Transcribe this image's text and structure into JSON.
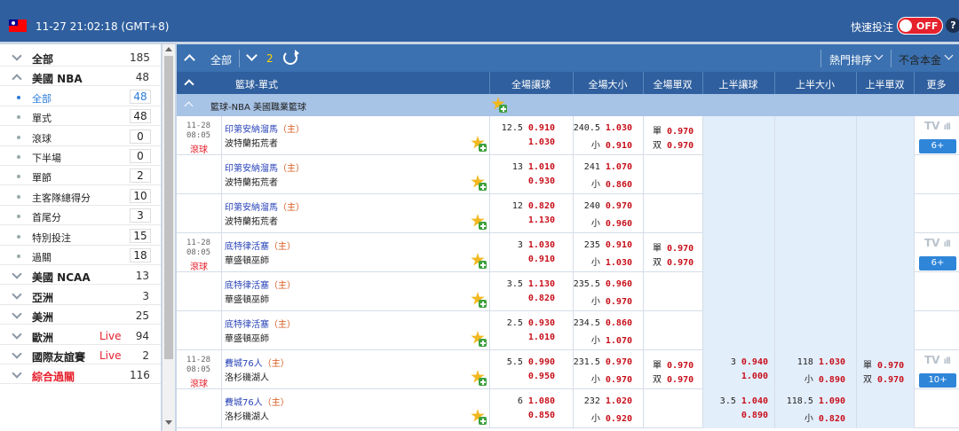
{
  "header": {
    "datetime": "11-27 21:02:18 (GMT+8)",
    "quick_bet_label": "快速投注",
    "quick_bet_state": "OFF",
    "help_label": "?",
    "colors": {
      "top_bar": "#2f5f9e",
      "toggle": "#e5212d"
    }
  },
  "sidebar": {
    "items": [
      {
        "label": "全部",
        "count": "185",
        "expanded": false
      },
      {
        "label": "美國 NBA",
        "count": "48",
        "expanded": true
      },
      {
        "label": "全部",
        "count": "48",
        "sub": true,
        "active": true
      },
      {
        "label": "單式",
        "count": "48",
        "sub": true
      },
      {
        "label": "滾球",
        "count": "0",
        "sub": true
      },
      {
        "label": "下半場",
        "count": "0",
        "sub": true
      },
      {
        "label": "單節",
        "count": "2",
        "sub": true
      },
      {
        "label": "主客隊總得分",
        "count": "10",
        "sub": true
      },
      {
        "label": "首尾分",
        "count": "3",
        "sub": true
      },
      {
        "label": "特別投注",
        "count": "15",
        "sub": true
      },
      {
        "label": "過關",
        "count": "18",
        "sub": true
      },
      {
        "label": "美國 NCAA",
        "count": "13",
        "expanded": false
      },
      {
        "label": "亞洲",
        "count": "3",
        "expanded": false
      },
      {
        "label": "美洲",
        "count": "25",
        "expanded": false
      },
      {
        "label": "歐洲",
        "count": "94",
        "live": "Live",
        "expanded": false
      },
      {
        "label": "國際友誼賽",
        "count": "2",
        "live": "Live",
        "expanded": false
      },
      {
        "label": "綜合過關",
        "count": "116",
        "highlight": true,
        "expanded": false
      }
    ]
  },
  "toolbar": {
    "all_label": "全部",
    "collapse_count": "2",
    "sort_label": "熱門排序",
    "odds_label": "不含本金"
  },
  "table": {
    "headers": [
      "籃球-單式",
      "全場讓球",
      "全場大小",
      "全場單双",
      "上半讓球",
      "上半大小",
      "上半單双",
      "更多"
    ],
    "league": "籃球-NBA 美國職業籃球",
    "home_suffix": "（主）",
    "matches": [
      {
        "date": "11-28",
        "time": "08:05",
        "live": "滾球",
        "home": "印第安納溜馬",
        "away": "波特蘭拓荒者",
        "hdp": "12.5",
        "hdp_h": "0.910",
        "hdp_a": "1.030",
        "ou": "240.5",
        "ou_o": "1.030",
        "ou_u_label": "小",
        "ou_u": "0.910",
        "oe_o_label": "單",
        "oe_o": "0.970",
        "oe_e_label": "双",
        "oe_e": "0.970",
        "tv": "TV",
        "more": "6+"
      },
      {
        "home": "印第安納溜馬",
        "away": "波特蘭拓荒者",
        "hdp": "13",
        "hdp_h": "1.010",
        "hdp_a": "0.930",
        "ou": "241",
        "ou_o": "1.070",
        "ou_u_label": "小",
        "ou_u": "0.860"
      },
      {
        "home": "印第安納溜馬",
        "away": "波特蘭拓荒者",
        "hdp": "12",
        "hdp_h": "0.820",
        "hdp_a": "1.130",
        "ou": "240",
        "ou_o": "0.970",
        "ou_u_label": "小",
        "ou_u": "0.960"
      },
      {
        "date": "11-28",
        "time": "08:05",
        "live": "滾球",
        "home": "底特律活塞",
        "away": "華盛頓巫師",
        "hdp": "3",
        "hdp_h": "1.030",
        "hdp_a": "0.910",
        "ou": "235",
        "ou_o": "0.910",
        "ou_u_label": "小",
        "ou_u": "1.030",
        "oe_o_label": "單",
        "oe_o": "0.970",
        "oe_e_label": "双",
        "oe_e": "0.970",
        "tv": "TV",
        "more": "6+"
      },
      {
        "home": "底特律活塞",
        "away": "華盛頓巫師",
        "hdp": "3.5",
        "hdp_h": "1.130",
        "hdp_a": "0.820",
        "ou": "235.5",
        "ou_o": "0.960",
        "ou_u_label": "小",
        "ou_u": "0.970"
      },
      {
        "home": "底特律活塞",
        "away": "華盛頓巫師",
        "hdp": "2.5",
        "hdp_h": "0.930",
        "hdp_a": "1.010",
        "ou": "234.5",
        "ou_o": "0.860",
        "ou_u_label": "小",
        "ou_u": "1.070"
      },
      {
        "date": "11-28",
        "time": "08:05",
        "live": "滾球",
        "home": "費城76人",
        "away": "洛杉磯湖人",
        "hdp": "5.5",
        "hdp_h": "0.990",
        "hdp_a": "0.950",
        "ou": "231.5",
        "ou_o": "0.970",
        "ou_u_label": "小",
        "ou_u": "0.970",
        "oe_o_label": "單",
        "oe_o": "0.970",
        "oe_e_label": "双",
        "oe_e": "0.970",
        "h1_hdp": "3",
        "h1_hdp_h": "0.940",
        "h1_hdp_a": "1.000",
        "h1_ou": "118",
        "h1_ou_o": "1.030",
        "h1_ou_u_label": "小",
        "h1_ou_u": "0.890",
        "h1_oe_o_label": "單",
        "h1_oe_o": "0.970",
        "h1_oe_e_label": "双",
        "h1_oe_e": "0.970",
        "tv": "TV",
        "more": "10+"
      },
      {
        "home": "費城76人",
        "away": "洛杉磯湖人",
        "hdp": "6",
        "hdp_h": "1.080",
        "hdp_a": "0.850",
        "ou": "232",
        "ou_o": "1.020",
        "ou_u_label": "小",
        "ou_u": "0.920",
        "h1_hdp": "3.5",
        "h1_hdp_h": "1.040",
        "h1_hdp_a": "0.890",
        "h1_ou": "118.5",
        "h1_ou_o": "1.090",
        "h1_ou_u_label": "小",
        "h1_ou_u": "0.820"
      }
    ]
  }
}
